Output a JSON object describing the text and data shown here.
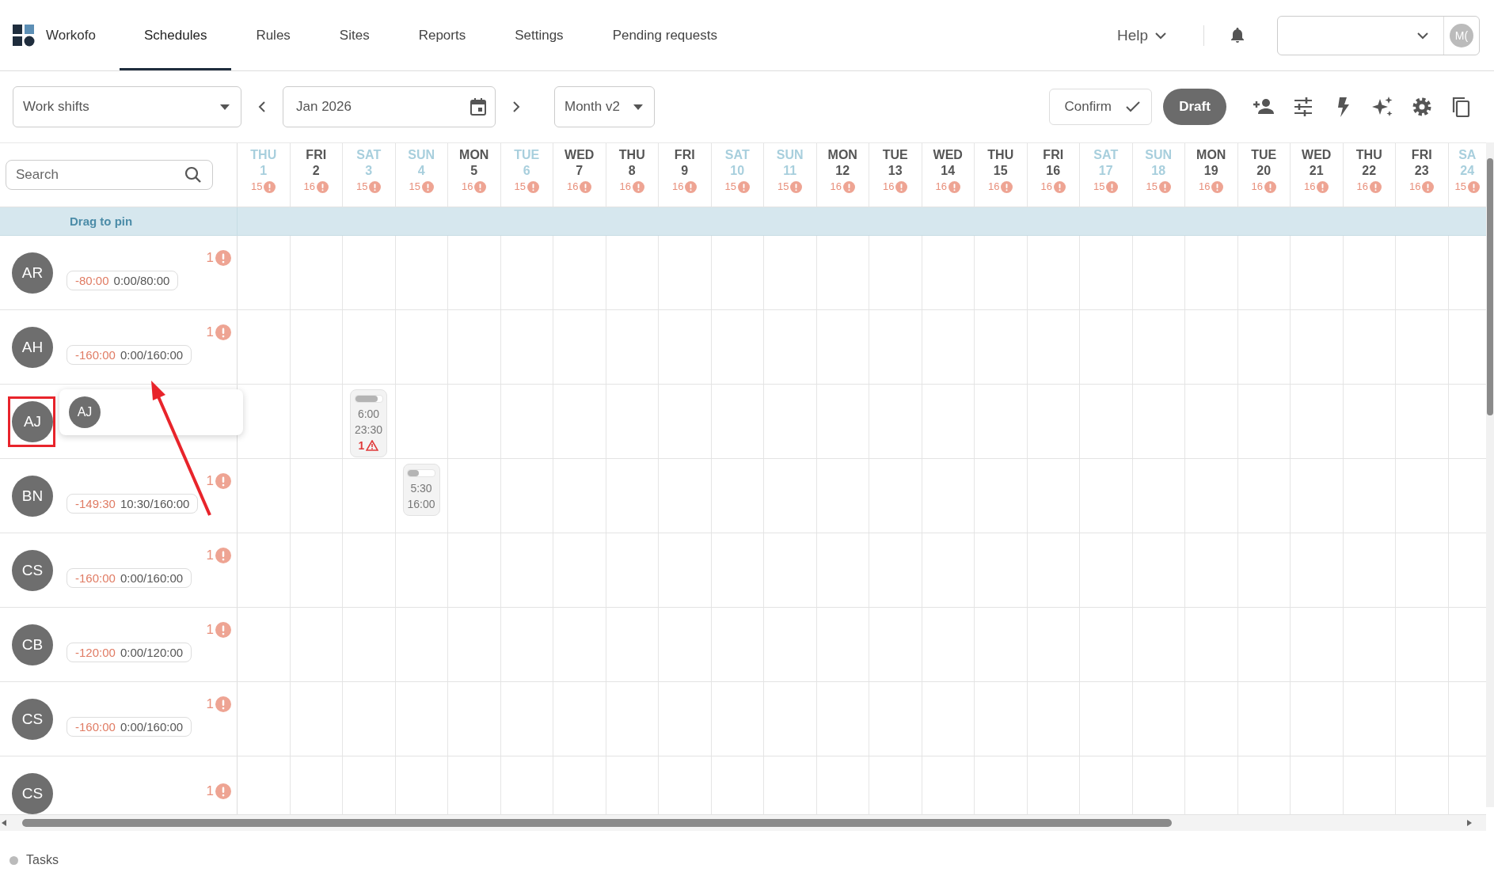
{
  "nav": {
    "brand": "Workofo",
    "tabs": [
      {
        "label": "Schedules",
        "selected": true
      },
      {
        "label": "Rules",
        "selected": false
      },
      {
        "label": "Sites",
        "selected": false
      },
      {
        "label": "Reports",
        "selected": false
      },
      {
        "label": "Settings",
        "selected": false
      },
      {
        "label": "Pending requests",
        "selected": false
      }
    ],
    "help": "Help",
    "avatar": "M("
  },
  "toolbar": {
    "view_select": "Work shifts",
    "date": "Jan 2026",
    "mode_select": "Month v2",
    "confirm": "Confirm",
    "draft": "Draft"
  },
  "grid": {
    "search_placeholder": "Search",
    "pin_label": "Drag to pin",
    "days": [
      {
        "weekday": "THU",
        "day": "1",
        "count": "15",
        "kind": "off"
      },
      {
        "weekday": "FRI",
        "day": "2",
        "count": "16",
        "kind": "work"
      },
      {
        "weekday": "SAT",
        "day": "3",
        "count": "15",
        "kind": "off"
      },
      {
        "weekday": "SUN",
        "day": "4",
        "count": "15",
        "kind": "off"
      },
      {
        "weekday": "MON",
        "day": "5",
        "count": "16",
        "kind": "work"
      },
      {
        "weekday": "TUE",
        "day": "6",
        "count": "15",
        "kind": "off"
      },
      {
        "weekday": "WED",
        "day": "7",
        "count": "16",
        "kind": "work"
      },
      {
        "weekday": "THU",
        "day": "8",
        "count": "16",
        "kind": "work"
      },
      {
        "weekday": "FRI",
        "day": "9",
        "count": "16",
        "kind": "work"
      },
      {
        "weekday": "SAT",
        "day": "10",
        "count": "15",
        "kind": "off"
      },
      {
        "weekday": "SUN",
        "day": "11",
        "count": "15",
        "kind": "off"
      },
      {
        "weekday": "MON",
        "day": "12",
        "count": "16",
        "kind": "work"
      },
      {
        "weekday": "TUE",
        "day": "13",
        "count": "16",
        "kind": "work"
      },
      {
        "weekday": "WED",
        "day": "14",
        "count": "16",
        "kind": "work"
      },
      {
        "weekday": "THU",
        "day": "15",
        "count": "16",
        "kind": "work"
      },
      {
        "weekday": "FRI",
        "day": "16",
        "count": "16",
        "kind": "work"
      },
      {
        "weekday": "SAT",
        "day": "17",
        "count": "15",
        "kind": "off"
      },
      {
        "weekday": "SUN",
        "day": "18",
        "count": "15",
        "kind": "off"
      },
      {
        "weekday": "MON",
        "day": "19",
        "count": "16",
        "kind": "work"
      },
      {
        "weekday": "TUE",
        "day": "20",
        "count": "16",
        "kind": "work"
      },
      {
        "weekday": "WED",
        "day": "21",
        "count": "16",
        "kind": "work"
      },
      {
        "weekday": "THU",
        "day": "22",
        "count": "16",
        "kind": "work"
      },
      {
        "weekday": "FRI",
        "day": "23",
        "count": "16",
        "kind": "work"
      },
      {
        "weekday": "SA",
        "day": "24",
        "count": "15",
        "kind": "off"
      }
    ],
    "employees": [
      {
        "initials": "AR",
        "deficit": "-80:00",
        "hours": "0:00/80:00",
        "alerts": "1",
        "highlighted": false
      },
      {
        "initials": "AH",
        "deficit": "-160:00",
        "hours": "0:00/160:00",
        "alerts": "1",
        "highlighted": false
      },
      {
        "initials": "AJ",
        "highlighted": true,
        "drag_preview": {
          "initials": "AJ"
        },
        "cells": [
          null,
          null,
          {
            "start": "6:00",
            "end": "23:30",
            "level": 0.85,
            "warnings": "1"
          },
          null,
          null,
          null,
          null,
          null,
          null,
          null,
          null,
          null,
          null,
          null,
          null,
          null,
          null,
          null,
          null,
          null,
          null,
          null,
          null,
          null
        ]
      },
      {
        "initials": "BN",
        "deficit": "-149:30",
        "hours": "10:30/160:00",
        "alerts": "1",
        "highlighted": false,
        "cells": [
          null,
          null,
          null,
          {
            "start": "5:30",
            "end": "16:00",
            "level": 0.4
          },
          null,
          null,
          null,
          null,
          null,
          null,
          null,
          null,
          null,
          null,
          null,
          null,
          null,
          null,
          null,
          null,
          null,
          null,
          null,
          null
        ]
      },
      {
        "initials": "CS",
        "deficit": "-160:00",
        "hours": "0:00/160:00",
        "alerts": "1",
        "highlighted": false
      },
      {
        "initials": "CB",
        "deficit": "-120:00",
        "hours": "0:00/120:00",
        "alerts": "1",
        "highlighted": false
      },
      {
        "initials": "CS",
        "deficit": "-160:00",
        "hours": "0:00/160:00",
        "alerts": "1",
        "highlighted": false
      },
      {
        "initials": "CS",
        "alerts": "1",
        "highlighted": false
      }
    ]
  },
  "footer": {
    "tasks": "Tasks"
  }
}
